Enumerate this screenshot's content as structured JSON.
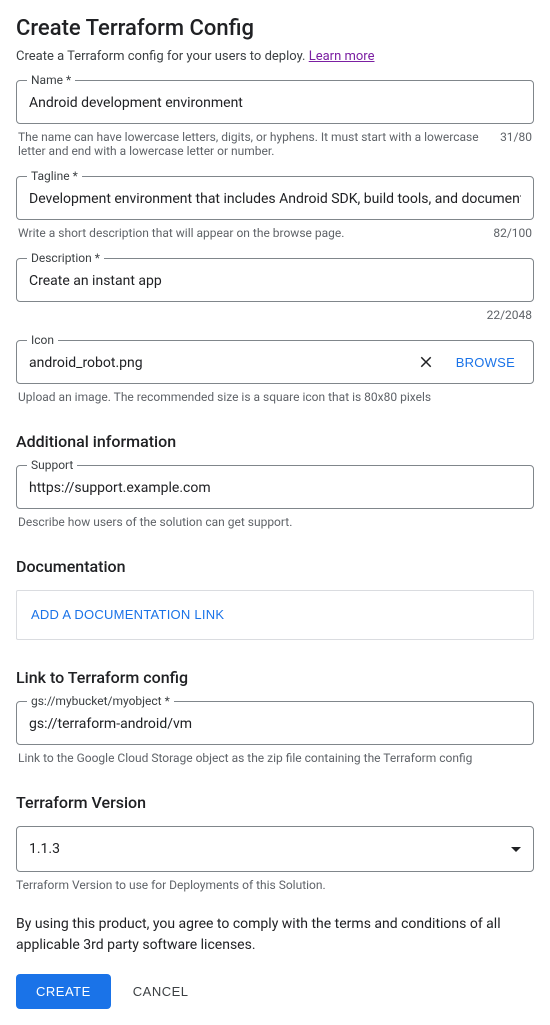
{
  "header": {
    "title": "Create Terraform Config",
    "subtitle": "Create a Terraform config for your users to deploy.",
    "learn_more": "Learn more"
  },
  "fields": {
    "name": {
      "label": "Name *",
      "value": "Android development environment",
      "help": "The name can have lowercase letters, digits, or hyphens. It must start with a lowercase letter and end with a lowercase letter or number.",
      "counter": "31/80"
    },
    "tagline": {
      "label": "Tagline *",
      "value": "Development environment that includes Android SDK, build tools, and documentation.",
      "help": "Write a short description that will appear on the browse page.",
      "counter": "82/100"
    },
    "description": {
      "label": "Description *",
      "value": "Create an instant app",
      "counter": "22/2048"
    },
    "icon": {
      "label": "Icon",
      "value": "android_robot.png",
      "browse": "BROWSE",
      "help": "Upload an image. The recommended size is a square icon that is 80x80 pixels"
    },
    "support": {
      "label": "Support",
      "value": "https://support.example.com",
      "help": "Describe how users of the solution can get support."
    },
    "config_link": {
      "label": "gs://mybucket/myobject *",
      "value": "gs://terraform-android/vm",
      "help": "Link to the Google Cloud Storage object as the zip file containing the Terraform config"
    },
    "version": {
      "value": "1.1.3",
      "help": "Terraform Version to use for Deployments of this Solution."
    }
  },
  "sections": {
    "additional_info": "Additional information",
    "documentation": "Documentation",
    "add_doc_link": "ADD A DOCUMENTATION LINK",
    "link_config": "Link to Terraform config",
    "tf_version": "Terraform Version"
  },
  "agreement": "By using this product, you agree to comply with the terms and conditions of all applicable 3rd party software licenses.",
  "buttons": {
    "create": "CREATE",
    "cancel": "CANCEL"
  }
}
